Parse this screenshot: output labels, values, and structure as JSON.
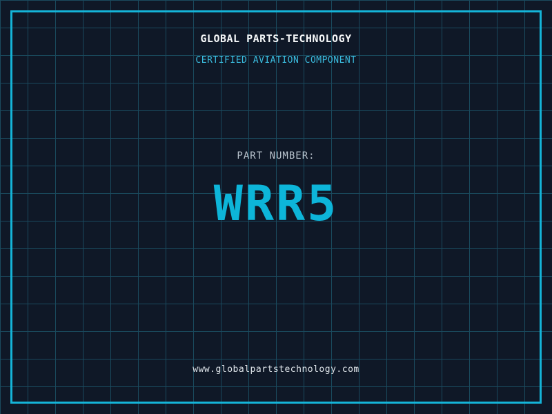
{
  "theme": {
    "background": "#0f1827",
    "grid_line": "#1a4a5e",
    "frame": "#14b4d8",
    "accent_cyan": "#0db5d9",
    "subtitle_cyan": "#3bbde0",
    "title_white": "#f5f7f8",
    "label_gray": "#b9c3cd",
    "url_gray": "#dfe5ea"
  },
  "header": {
    "title": "GLOBAL PARTS-TECHNOLOGY",
    "subtitle": "CERTIFIED AVIATION COMPONENT"
  },
  "part": {
    "label": "PART NUMBER:",
    "number": "WRR5"
  },
  "footer": {
    "url": "www.globalpartstechnology.com"
  }
}
